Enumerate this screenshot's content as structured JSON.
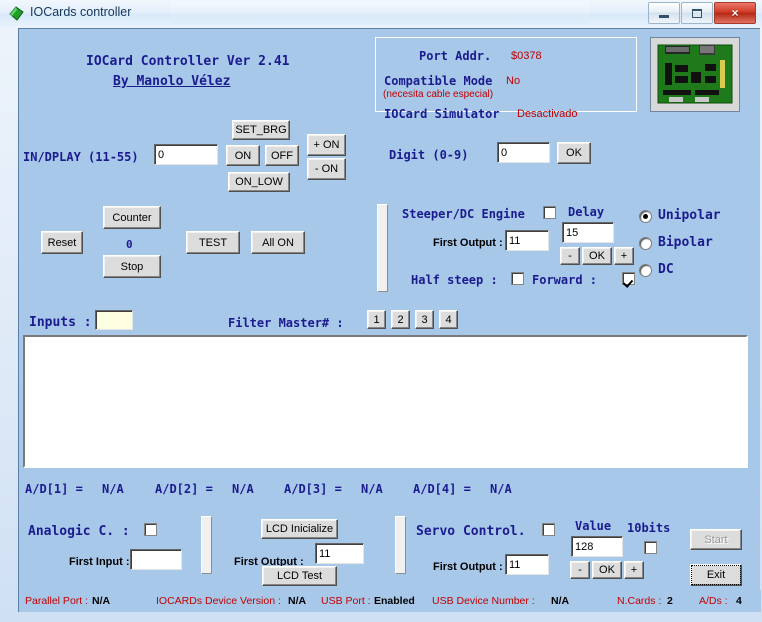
{
  "window": {
    "title": "IOCards controller",
    "icon": "app-diamond-icon",
    "minimize": "minimize-icon",
    "maximize": "maximize-icon",
    "close": "×"
  },
  "header": {
    "app_title": "IOCard Controller  Ver 2.41",
    "author": "By Manolo Vélez"
  },
  "info_panel": {
    "port_addr_label": "Port Addr.",
    "port_addr_value": "$0378",
    "compatible_label": "Compatible Mode",
    "compatible_value": "No",
    "compatible_note": "(necesita cable especial)",
    "simulator_label": "IOCard Simulator",
    "simulator_value": "Desactivado",
    "board_image": "iocard-board-photo"
  },
  "indplay": {
    "label": "IN/DPLAY (11-55)",
    "value": "0",
    "set_brg": "SET_BRG",
    "on": "ON",
    "off": "OFF",
    "on_low": "ON_LOW",
    "plus_on": "+ ON",
    "minus_on": "- ON"
  },
  "digit": {
    "label": "Digit (0-9)",
    "value": "0",
    "ok": "OK"
  },
  "counter": {
    "reset": "Reset",
    "counter": "Counter",
    "value": "0",
    "stop": "Stop",
    "test": "TEST",
    "all_on": "All ON"
  },
  "stepper": {
    "title": "Steeper/DC Engine",
    "enabled": false,
    "first_output_label": "First Output :",
    "first_output_value": "11",
    "delay_label": "Delay",
    "delay_value": "15",
    "minus": "-",
    "ok": "OK",
    "plus": "+",
    "half_steep_label": "Half steep :",
    "half_steep_checked": false,
    "forward_label": "Forward  :",
    "forward_checked": true,
    "modes": [
      {
        "label": "Unipolar",
        "selected": true
      },
      {
        "label": "Bipolar",
        "selected": false
      },
      {
        "label": "DC",
        "selected": false
      }
    ]
  },
  "inputs": {
    "label": "Inputs :",
    "value": "",
    "filter_label": "Filter Master# :",
    "filter_buttons": [
      "1",
      "2",
      "3",
      "4"
    ]
  },
  "log": {
    "value": ""
  },
  "ad": [
    {
      "label": "A/D[1] =",
      "value": "N/A"
    },
    {
      "label": "A/D[2] =",
      "value": "N/A"
    },
    {
      "label": "A/D[3] =",
      "value": "N/A"
    },
    {
      "label": "A/D[4] =",
      "value": "N/A"
    }
  ],
  "analogic": {
    "title": "Analogic C. :",
    "enabled": false,
    "first_input_label": "First Input  :",
    "first_input_value": ""
  },
  "lcd": {
    "inicialize": "LCD Inicialize",
    "first_output_label": "First Output :",
    "first_output_value": "11",
    "test": "LCD Test"
  },
  "servo": {
    "title": "Servo Control.",
    "enabled": false,
    "first_output_label": "First Output :",
    "first_output_value": "11",
    "value_label": "Value",
    "value": "128",
    "minus": "-",
    "ok": "OK",
    "plus": "+",
    "tenbits_label": "10bits",
    "tenbits_checked": false,
    "start": "Start",
    "exit": "Exit"
  },
  "status": {
    "parallel_label": "Parallel Port :",
    "parallel_value": "N/A",
    "device_label": "IOCARDs Device  Version :",
    "device_value": "N/A",
    "usb_label": "USB Port :",
    "usb_value": "Enabled",
    "usbnum_label": "USB Device Number :",
    "usbnum_value": "N/A",
    "ncards_label": "N.Cards :",
    "ncards_value": "2",
    "ads_label": "A/Ds :",
    "ads_value": "4"
  },
  "colors": {
    "client_bg": "#a8c8ea",
    "label_blue": "#1b1b8f",
    "status_red": "#c00000"
  }
}
